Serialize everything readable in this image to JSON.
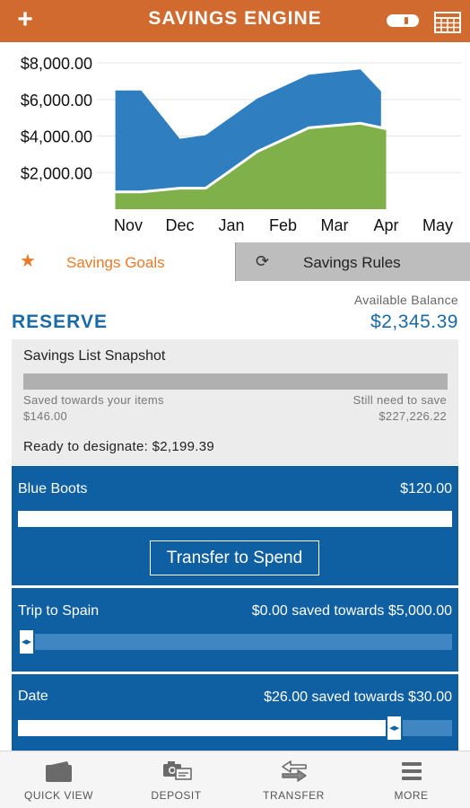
{
  "header": {
    "title": "SAVINGS ENGINE",
    "add_label": "+"
  },
  "chart_data": {
    "type": "area",
    "categories": [
      "Nov",
      "Dec",
      "Jan",
      "Feb",
      "Mar",
      "Apr",
      "May"
    ],
    "ytick_labels": [
      "$2,000.00",
      "$4,000.00",
      "$6,000.00",
      "$8,000.00"
    ],
    "yticks": [
      2000,
      4000,
      6000,
      8000
    ],
    "ylim": [
      0,
      8300
    ],
    "x": [
      -0.25,
      0.25,
      1.0,
      1.5,
      2.5,
      3.5,
      4.5,
      5.0,
      5.35
    ],
    "series": [
      {
        "values": [
          6500,
          6500,
          3850,
          4050,
          6050,
          7350,
          7650,
          6450
        ]
      },
      {
        "values": [
          950,
          950,
          1150,
          1150,
          3150,
          4450,
          4700,
          4400
        ]
      }
    ],
    "series_x": [
      [
        -0.25,
        0.25,
        1.0,
        1.5,
        2.5,
        3.5,
        4.5,
        4.9,
        5.35
      ],
      [
        -0.25,
        0.25,
        1.0,
        1.5,
        2.5,
        3.5,
        4.5,
        5.0,
        5.35
      ]
    ],
    "colors": {
      "outer": "#2f7ec0",
      "inner": "#7fb04a",
      "line": "#ffffff"
    },
    "grid": true
  },
  "tabs": {
    "goals_label": "Savings Goals",
    "rules_label": "Savings Rules"
  },
  "balance": {
    "label": "Available Balance",
    "account": "RESERVE",
    "amount": "$2,345.39"
  },
  "snapshot": {
    "heading": "Savings List Snapshot",
    "saved_label": "Saved towards your items",
    "saved_value": "$146.00",
    "need_label": "Still need to save",
    "need_value": "$227,226.22",
    "ready_text": "Ready to designate: $2,199.39"
  },
  "goals": [
    {
      "name": "Blue Boots",
      "amount": "$120.00",
      "progress": 1.0,
      "button": "Transfer to Spend"
    },
    {
      "name": "Trip to Spain",
      "amount": "$0.00 saved towards $5,000.00",
      "progress": 0.0
    },
    {
      "name": "Date",
      "amount": "$26.00 saved towards $30.00",
      "progress": 0.867
    }
  ],
  "nav": [
    {
      "label": "QUICK VIEW",
      "icon": "wallet-icon"
    },
    {
      "label": "DEPOSIT",
      "icon": "camera-check-icon"
    },
    {
      "label": "TRANSFER",
      "icon": "transfer-arrows-icon"
    },
    {
      "label": "MORE",
      "icon": "menu-icon"
    }
  ]
}
